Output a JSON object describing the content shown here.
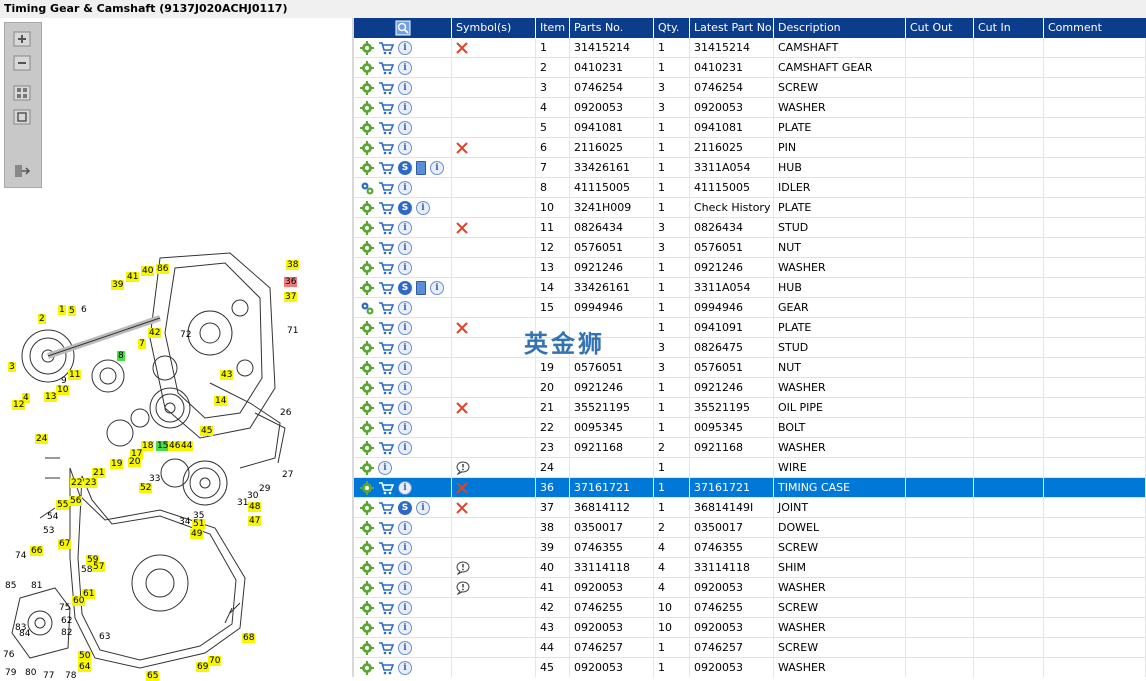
{
  "window": {
    "title": "Timing Gear & Camshaft (9137J020ACHJ0117)"
  },
  "watermark": "英金狮",
  "colors": {
    "header_bg": "#0b3d8c",
    "selected_row_bg": "#0078d7",
    "callout_yellow": "#f6f600",
    "callout_red": "#f07878",
    "callout_green": "#44dd44",
    "symbol_x": "#e0422a"
  },
  "toolbar": {
    "tools": [
      "zoom-in-icon",
      "zoom-out-icon",
      "fit-all-icon",
      "actual-size-icon",
      "export-icon"
    ]
  },
  "grid": {
    "headers": {
      "icons": "",
      "symbols": "Symbol(s)",
      "item": "Item",
      "parts_no": "Parts No.",
      "qty": "Qty.",
      "latest_part_no": "Latest Part No.",
      "description": "Description",
      "cut_out": "Cut Out",
      "cut_in": "Cut In",
      "comment": "Comment"
    },
    "rows": [
      {
        "item": "1",
        "parts_no": "31415214",
        "qty": "1",
        "latest": "31415214",
        "desc": "CAMSHAFT",
        "icons": [
          "gear",
          "cart",
          "info"
        ],
        "symbol": "x"
      },
      {
        "item": "2",
        "parts_no": "0410231",
        "qty": "1",
        "latest": "0410231",
        "desc": "CAMSHAFT GEAR",
        "icons": [
          "gear",
          "cart",
          "info"
        ],
        "symbol": ""
      },
      {
        "item": "3",
        "parts_no": "0746254",
        "qty": "3",
        "latest": "0746254",
        "desc": "SCREW",
        "icons": [
          "gear",
          "cart",
          "info"
        ],
        "symbol": ""
      },
      {
        "item": "4",
        "parts_no": "0920053",
        "qty": "3",
        "latest": "0920053",
        "desc": "WASHER",
        "icons": [
          "gear",
          "cart",
          "info"
        ],
        "symbol": ""
      },
      {
        "item": "5",
        "parts_no": "0941081",
        "qty": "1",
        "latest": "0941081",
        "desc": "PLATE",
        "icons": [
          "gear",
          "cart",
          "info"
        ],
        "symbol": ""
      },
      {
        "item": "6",
        "parts_no": "2116025",
        "qty": "1",
        "latest": "2116025",
        "desc": "PIN",
        "icons": [
          "gear",
          "cart",
          "info"
        ],
        "symbol": "x"
      },
      {
        "item": "7",
        "parts_no": "33426161",
        "qty": "1",
        "latest": "3311A054",
        "desc": "HUB",
        "icons": [
          "gear",
          "cart",
          "s",
          "book",
          "info"
        ],
        "symbol": ""
      },
      {
        "item": "8",
        "parts_no": "41115005",
        "qty": "1",
        "latest": "41115005",
        "desc": "IDLER",
        "icons": [
          "gears",
          "cart",
          "info"
        ],
        "symbol": ""
      },
      {
        "item": "10",
        "parts_no": "3241H009",
        "qty": "1",
        "latest": "Check History",
        "desc": "PLATE",
        "icons": [
          "gear",
          "cart",
          "s",
          "info"
        ],
        "symbol": ""
      },
      {
        "item": "11",
        "parts_no": "0826434",
        "qty": "3",
        "latest": "0826434",
        "desc": "STUD",
        "icons": [
          "gear",
          "cart",
          "info"
        ],
        "symbol": "x"
      },
      {
        "item": "12",
        "parts_no": "0576051",
        "qty": "3",
        "latest": "0576051",
        "desc": "NUT",
        "icons": [
          "gear",
          "cart",
          "info"
        ],
        "symbol": ""
      },
      {
        "item": "13",
        "parts_no": "0921246",
        "qty": "1",
        "latest": "0921246",
        "desc": "WASHER",
        "icons": [
          "gear",
          "cart",
          "info"
        ],
        "symbol": ""
      },
      {
        "item": "14",
        "parts_no": "33426161",
        "qty": "1",
        "latest": "3311A054",
        "desc": "HUB",
        "icons": [
          "gear",
          "cart",
          "s",
          "book",
          "info"
        ],
        "symbol": ""
      },
      {
        "item": "15",
        "parts_no": "0994946",
        "qty": "1",
        "latest": "0994946",
        "desc": "GEAR",
        "icons": [
          "gears",
          "cart",
          "info"
        ],
        "symbol": ""
      },
      {
        "item": "",
        "parts_no": "",
        "qty": "1",
        "latest": "0941091",
        "desc": "PLATE",
        "icons": [
          "gear",
          "cart",
          "info"
        ],
        "symbol": "x"
      },
      {
        "item": "",
        "parts_no": "",
        "qty": "3",
        "latest": "0826475",
        "desc": "STUD",
        "icons": [
          "gear",
          "cart",
          "info"
        ],
        "symbol": ""
      },
      {
        "item": "19",
        "parts_no": "0576051",
        "qty": "3",
        "latest": "0576051",
        "desc": "NUT",
        "icons": [
          "gear",
          "cart",
          "info"
        ],
        "symbol": ""
      },
      {
        "item": "20",
        "parts_no": "0921246",
        "qty": "1",
        "latest": "0921246",
        "desc": "WASHER",
        "icons": [
          "gear",
          "cart",
          "info"
        ],
        "symbol": ""
      },
      {
        "item": "21",
        "parts_no": "35521195",
        "qty": "1",
        "latest": "35521195",
        "desc": "OIL PIPE",
        "icons": [
          "gear",
          "cart",
          "info"
        ],
        "symbol": "x"
      },
      {
        "item": "22",
        "parts_no": "0095345",
        "qty": "1",
        "latest": "0095345",
        "desc": "BOLT",
        "icons": [
          "gear",
          "cart",
          "info"
        ],
        "symbol": ""
      },
      {
        "item": "23",
        "parts_no": "0921168",
        "qty": "2",
        "latest": "0921168",
        "desc": "WASHER",
        "icons": [
          "gear",
          "cart",
          "info"
        ],
        "symbol": ""
      },
      {
        "item": "24",
        "parts_no": "",
        "qty": "1",
        "latest": "",
        "desc": "WIRE",
        "icons": [
          "gear",
          "info"
        ],
        "symbol": "note"
      },
      {
        "item": "36",
        "parts_no": "37161721",
        "qty": "1",
        "latest": "37161721",
        "desc": "TIMING CASE",
        "icons": [
          "gear",
          "cart",
          "info"
        ],
        "symbol": "x",
        "selected": true
      },
      {
        "item": "37",
        "parts_no": "36814112",
        "qty": "1",
        "latest": "36814149I",
        "desc": "JOINT",
        "icons": [
          "gear",
          "cart",
          "s",
          "info"
        ],
        "symbol": "x"
      },
      {
        "item": "38",
        "parts_no": "0350017",
        "qty": "2",
        "latest": "0350017",
        "desc": "DOWEL",
        "icons": [
          "gear",
          "cart",
          "info"
        ],
        "symbol": ""
      },
      {
        "item": "39",
        "parts_no": "0746355",
        "qty": "4",
        "latest": "0746355",
        "desc": "SCREW",
        "icons": [
          "gear",
          "cart",
          "info"
        ],
        "symbol": ""
      },
      {
        "item": "40",
        "parts_no": "33114118",
        "qty": "4",
        "latest": "33114118",
        "desc": "SHIM",
        "icons": [
          "gear",
          "cart",
          "info"
        ],
        "symbol": "note"
      },
      {
        "item": "41",
        "parts_no": "0920053",
        "qty": "4",
        "latest": "0920053",
        "desc": "WASHER",
        "icons": [
          "gear",
          "cart",
          "info"
        ],
        "symbol": "note"
      },
      {
        "item": "42",
        "parts_no": "0746255",
        "qty": "10",
        "latest": "0746255",
        "desc": "SCREW",
        "icons": [
          "gear",
          "cart",
          "info"
        ],
        "symbol": ""
      },
      {
        "item": "43",
        "parts_no": "0920053",
        "qty": "10",
        "latest": "0920053",
        "desc": "WASHER",
        "icons": [
          "gear",
          "cart",
          "info"
        ],
        "symbol": ""
      },
      {
        "item": "44",
        "parts_no": "0746257",
        "qty": "1",
        "latest": "0746257",
        "desc": "SCREW",
        "icons": [
          "gear",
          "cart",
          "info"
        ],
        "symbol": ""
      },
      {
        "item": "45",
        "parts_no": "0920053",
        "qty": "1",
        "latest": "0920053",
        "desc": "WASHER",
        "icons": [
          "gear",
          "cart",
          "info"
        ],
        "symbol": ""
      }
    ]
  },
  "diagram": {
    "callouts": [
      {
        "label": "38",
        "type": "yellow"
      },
      {
        "label": "36",
        "type": "red"
      },
      {
        "label": "37",
        "type": "yellow"
      },
      {
        "label": "71",
        "type": "plain"
      },
      {
        "label": "39",
        "type": "yellow"
      },
      {
        "label": "41",
        "type": "yellow"
      },
      {
        "label": "40",
        "type": "yellow"
      },
      {
        "label": "86",
        "type": "yellow"
      },
      {
        "label": "2",
        "type": "yellow"
      },
      {
        "label": "1",
        "type": "yellow"
      },
      {
        "label": "5",
        "type": "yellow"
      },
      {
        "label": "6",
        "type": "plain"
      },
      {
        "label": "72",
        "type": "plain"
      },
      {
        "label": "7",
        "type": "yellow"
      },
      {
        "label": "42",
        "type": "yellow"
      },
      {
        "label": "8",
        "type": "green"
      },
      {
        "label": "3",
        "type": "yellow"
      },
      {
        "label": "43",
        "type": "yellow"
      },
      {
        "label": "11",
        "type": "yellow"
      },
      {
        "label": "10",
        "type": "yellow"
      },
      {
        "label": "13",
        "type": "yellow"
      },
      {
        "label": "9",
        "type": "plain"
      },
      {
        "label": "4",
        "type": "yellow"
      },
      {
        "label": "12",
        "type": "yellow"
      },
      {
        "label": "14",
        "type": "yellow"
      },
      {
        "label": "26",
        "type": "plain"
      },
      {
        "label": "24",
        "type": "yellow"
      },
      {
        "label": "45",
        "type": "yellow"
      },
      {
        "label": "18",
        "type": "yellow"
      },
      {
        "label": "15",
        "type": "green"
      },
      {
        "label": "46",
        "type": "yellow"
      },
      {
        "label": "44",
        "type": "yellow"
      },
      {
        "label": "17",
        "type": "yellow"
      },
      {
        "label": "19",
        "type": "yellow"
      },
      {
        "label": "20",
        "type": "yellow"
      },
      {
        "label": "21",
        "type": "yellow"
      },
      {
        "label": "23",
        "type": "yellow"
      },
      {
        "label": "22",
        "type": "yellow"
      },
      {
        "label": "33",
        "type": "plain"
      },
      {
        "label": "27",
        "type": "plain"
      },
      {
        "label": "52",
        "type": "yellow"
      },
      {
        "label": "29",
        "type": "plain"
      },
      {
        "label": "56",
        "type": "yellow"
      },
      {
        "label": "55",
        "type": "yellow"
      },
      {
        "label": "54",
        "type": "plain"
      },
      {
        "label": "53",
        "type": "plain"
      },
      {
        "label": "30",
        "type": "plain"
      },
      {
        "label": "31",
        "type": "plain"
      },
      {
        "label": "48",
        "type": "yellow"
      },
      {
        "label": "35",
        "type": "plain"
      },
      {
        "label": "34",
        "type": "plain"
      },
      {
        "label": "51",
        "type": "yellow"
      },
      {
        "label": "49",
        "type": "yellow"
      },
      {
        "label": "47",
        "type": "yellow"
      },
      {
        "label": "67",
        "type": "yellow"
      },
      {
        "label": "66",
        "type": "yellow"
      },
      {
        "label": "74",
        "type": "plain"
      },
      {
        "label": "59",
        "type": "yellow"
      },
      {
        "label": "58",
        "type": "plain"
      },
      {
        "label": "57",
        "type": "yellow"
      },
      {
        "label": "85",
        "type": "plain"
      },
      {
        "label": "81",
        "type": "plain"
      },
      {
        "label": "61",
        "type": "yellow"
      },
      {
        "label": "60",
        "type": "yellow"
      },
      {
        "label": "75",
        "type": "plain"
      },
      {
        "label": "62",
        "type": "plain"
      },
      {
        "label": "83",
        "type": "plain"
      },
      {
        "label": "84",
        "type": "plain"
      },
      {
        "label": "63",
        "type": "plain"
      },
      {
        "label": "68",
        "type": "yellow"
      },
      {
        "label": "76",
        "type": "plain"
      },
      {
        "label": "50",
        "type": "yellow"
      },
      {
        "label": "64",
        "type": "yellow"
      },
      {
        "label": "70",
        "type": "yellow"
      },
      {
        "label": "69",
        "type": "yellow"
      },
      {
        "label": "79",
        "type": "plain"
      },
      {
        "label": "80",
        "type": "plain"
      },
      {
        "label": "77",
        "type": "plain"
      },
      {
        "label": "78",
        "type": "plain"
      },
      {
        "label": "65",
        "type": "yellow"
      },
      {
        "label": "82",
        "type": "plain"
      }
    ]
  }
}
